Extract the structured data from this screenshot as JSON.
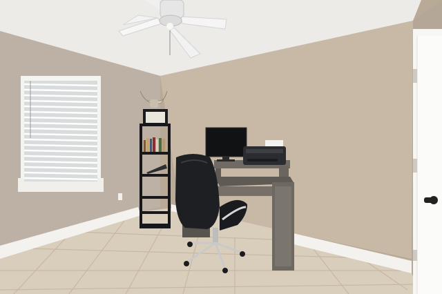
{
  "scene": {
    "description_free": true,
    "colors": {
      "ceiling": "#ecebe8",
      "wall_left": "#bcb1a4",
      "wall_back": "#c8b9a6",
      "wall_right": "#b4a797",
      "baseboard": "#f4f2ee",
      "floor": "#d9cdbb",
      "tile_line": "#c9bca8",
      "door": "#f7f6f3",
      "window_blind": "#f3f3f1",
      "dark_furniture": "#1d1d1f",
      "desk_wood": "#6f6a63",
      "monitor": "#111214"
    },
    "objects": [
      {
        "name": "ceiling-fan",
        "icon": "ceiling-fan-icon"
      },
      {
        "name": "window-with-blinds",
        "icon": "window-icon"
      },
      {
        "name": "black-bookshelf",
        "icon": "bookshelf-icon"
      },
      {
        "name": "longhorn-skull-decor",
        "icon": "skull-icon"
      },
      {
        "name": "computer-desk",
        "icon": "desk-icon"
      },
      {
        "name": "computer-monitor",
        "icon": "monitor-icon"
      },
      {
        "name": "printer",
        "icon": "printer-icon"
      },
      {
        "name": "office-chair",
        "icon": "chair-icon"
      },
      {
        "name": "white-door",
        "icon": "door-icon"
      },
      {
        "name": "wall-outlet",
        "icon": "outlet-icon"
      }
    ]
  }
}
